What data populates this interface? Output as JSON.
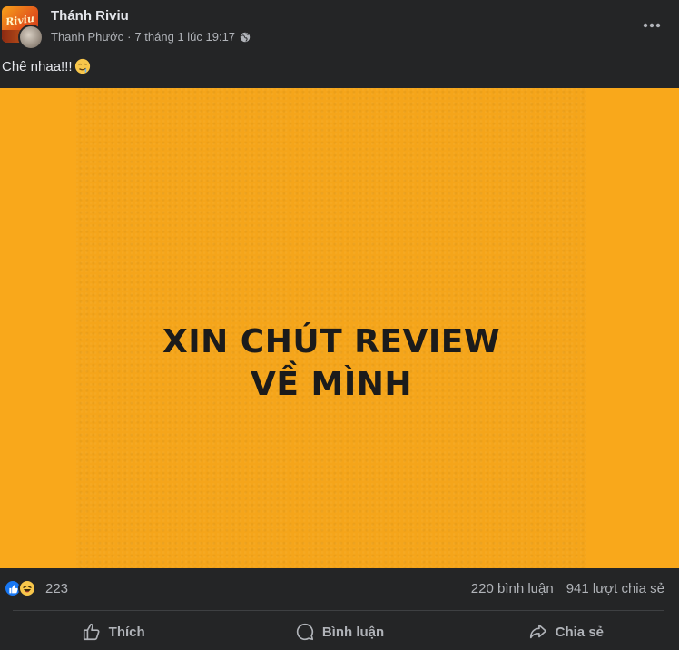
{
  "post": {
    "page_name": "Thánh Riviu",
    "avatar_logo_text": "Riviu",
    "author": "Thanh Phước",
    "separator": "·",
    "timestamp": "7 tháng 1 lúc 19:17",
    "privacy_icon": "globe-icon",
    "caption": "Chê nhaa!!!",
    "caption_emoji": "drooling-face-icon",
    "image_text_line1": "XIN CHÚT REVIEW",
    "image_text_line2": "VỀ MÌNH",
    "image_bg_color": "#f5a51a"
  },
  "reactions": {
    "icons": [
      "like-icon",
      "haha-icon"
    ],
    "count": "223",
    "comments": "220 bình luận",
    "shares": "941 lượt chia sẻ"
  },
  "actions": {
    "like_label": "Thích",
    "comment_label": "Bình luận",
    "share_label": "Chia sẻ"
  },
  "colors": {
    "background": "#242526",
    "primary_text": "#e4e6eb",
    "secondary_text": "#b0b3b8",
    "like_blue": "#1877f2"
  }
}
